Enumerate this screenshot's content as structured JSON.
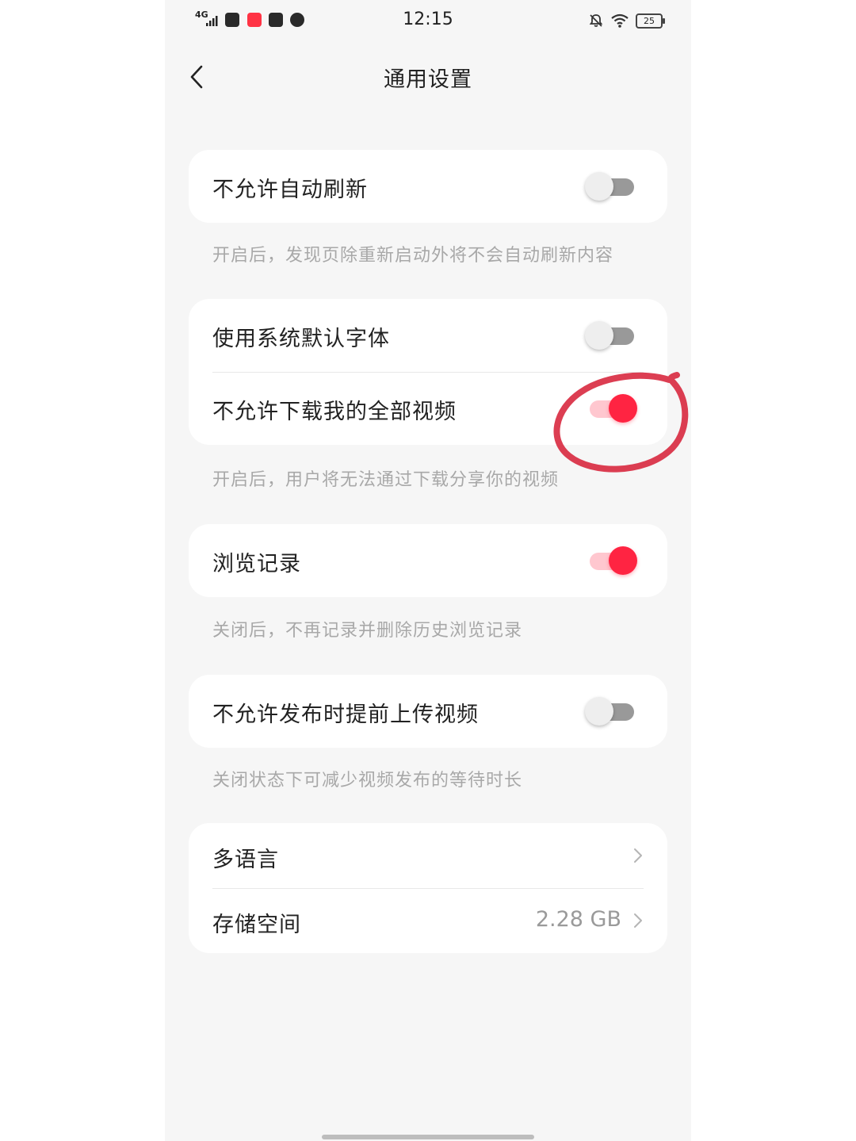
{
  "status_bar": {
    "network": "4G",
    "time": "12:15",
    "battery": "25"
  },
  "nav": {
    "title": "通用设置"
  },
  "settings": {
    "auto_refresh": {
      "label": "不允许自动刷新",
      "enabled": false,
      "description": "开启后，发现页除重新启动外将不会自动刷新内容"
    },
    "system_font": {
      "label": "使用系统默认字体",
      "enabled": false
    },
    "download_videos": {
      "label": "不允许下载我的全部视频",
      "enabled": true,
      "description": "开启后，用户将无法通过下载分享你的视频"
    },
    "browse_history": {
      "label": "浏览记录",
      "enabled": true,
      "description": "关闭后，不再记录并删除历史浏览记录"
    },
    "pre_upload": {
      "label": "不允许发布时提前上传视频",
      "enabled": false,
      "description": "关闭状态下可减少视频发布的等待时长"
    },
    "language": {
      "label": "多语言"
    },
    "storage": {
      "label": "存储空间",
      "value": "2.28 GB"
    }
  },
  "colors": {
    "accent": "#ff2442",
    "annotation": "#d8293f",
    "background": "#f6f6f6"
  }
}
